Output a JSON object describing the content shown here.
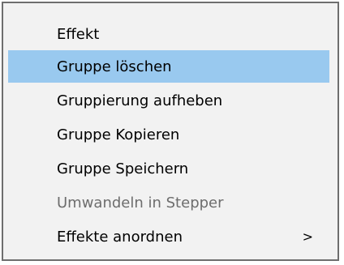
{
  "menu": {
    "items": [
      {
        "label": "Effekt",
        "state": "normal"
      },
      {
        "label": "Gruppe löschen",
        "state": "highlighted"
      },
      {
        "label": "Gruppierung aufheben",
        "state": "normal"
      },
      {
        "label": "Gruppe Kopieren",
        "state": "normal"
      },
      {
        "label": "Gruppe Speichern",
        "state": "normal"
      },
      {
        "label": "Umwandeln in Stepper",
        "state": "disabled"
      },
      {
        "label": "Effekte anordnen",
        "state": "normal",
        "submenu_indicator": ">"
      }
    ],
    "colors": {
      "highlight": "#99c9ef",
      "background": "#f2f2f2",
      "border": "#6e6e6e",
      "disabled_text": "#6d6d6d"
    }
  }
}
